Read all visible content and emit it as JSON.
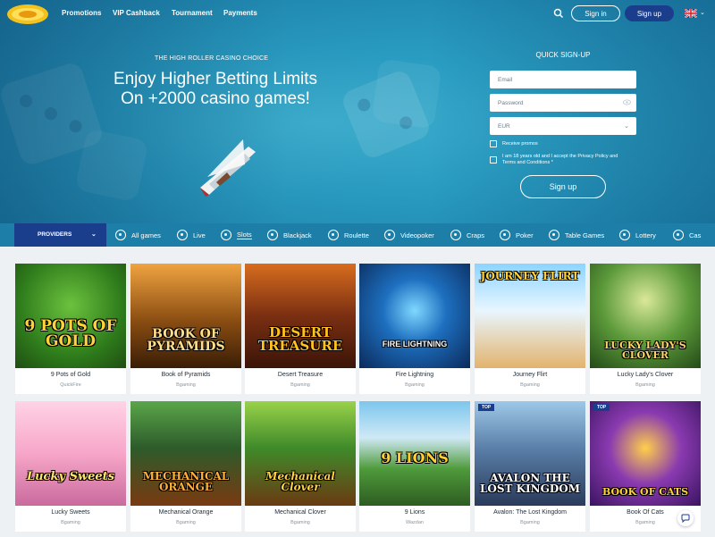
{
  "header": {
    "nav": [
      "Promotions",
      "VIP Cashback",
      "Tournament",
      "Payments"
    ],
    "signin_label": "Sign in",
    "signup_label": "Sign up"
  },
  "hero": {
    "kicker": "THE HIGH ROLLER CASINO CHOICE",
    "title_line1": "Enjoy Higher Betting Limits",
    "title_line2": "On +2000 casino games!"
  },
  "quick_signup": {
    "title": "QUICK SIGN-UP",
    "email_placeholder": "Email",
    "password_placeholder": "Password",
    "currency": "EUR",
    "receive_promos": "Receive promos",
    "terms_line1": "I am 18 years old and I accept the Privacy Policy and",
    "terms_line2": "Terms and Conditions *",
    "submit_label": "Sign up"
  },
  "categories": {
    "providers_label": "PROVIDERS",
    "items": [
      "All games",
      "Live",
      "Slots",
      "Blackjack",
      "Roulette",
      "Videopoker",
      "Craps",
      "Poker",
      "Table Games",
      "Lottery",
      "Cas"
    ],
    "active": "Slots"
  },
  "games": [
    {
      "name": "9 Pots of Gold",
      "provider": "QuickFire",
      "art": "9 POTS OF GOLD"
    },
    {
      "name": "Book of Pyramids",
      "provider": "Bgaming",
      "art": "BOOK OF PYRAMIDS"
    },
    {
      "name": "Desert Treasure",
      "provider": "Bgaming",
      "art": "DESERT TREASURE"
    },
    {
      "name": "Fire Lightning",
      "provider": "Bgaming",
      "art": "FIRE LIGHTNING"
    },
    {
      "name": "Journey Flirt",
      "provider": "Bgaming",
      "art": "JOURNEY FLIRT"
    },
    {
      "name": "Lucky Lady's Clover",
      "provider": "Bgaming",
      "art": "LUCKY LADY'S CLOVER"
    },
    {
      "name": "Lucky Sweets",
      "provider": "Bgaming",
      "art": "Lucky Sweets"
    },
    {
      "name": "Mechanical Orange",
      "provider": "Bgaming",
      "art": "MECHANICAL ORANGE"
    },
    {
      "name": "Mechanical Clover",
      "provider": "Bgaming",
      "art": "Mechanical Clover"
    },
    {
      "name": "9 Lions",
      "provider": "Wazdan",
      "art": "9 LIONS"
    },
    {
      "name": "Avalon: The Lost Kingdom",
      "provider": "Bgaming",
      "art": "AVALON THE LOST KINGDOM",
      "badge": "TOP"
    },
    {
      "name": "Book Of Cats",
      "provider": "Bgaming",
      "art": "BOOK OF CATS",
      "badge": "TOP"
    }
  ],
  "colors": {
    "hero": "#2a9dc2",
    "primary_button": "#1a3e8c",
    "category_bar": "#1d7fa8",
    "page_bg": "#eef1f4"
  },
  "icons": {
    "search": "search-icon",
    "language": "uk-flag-icon",
    "chat": "chat-icon"
  }
}
